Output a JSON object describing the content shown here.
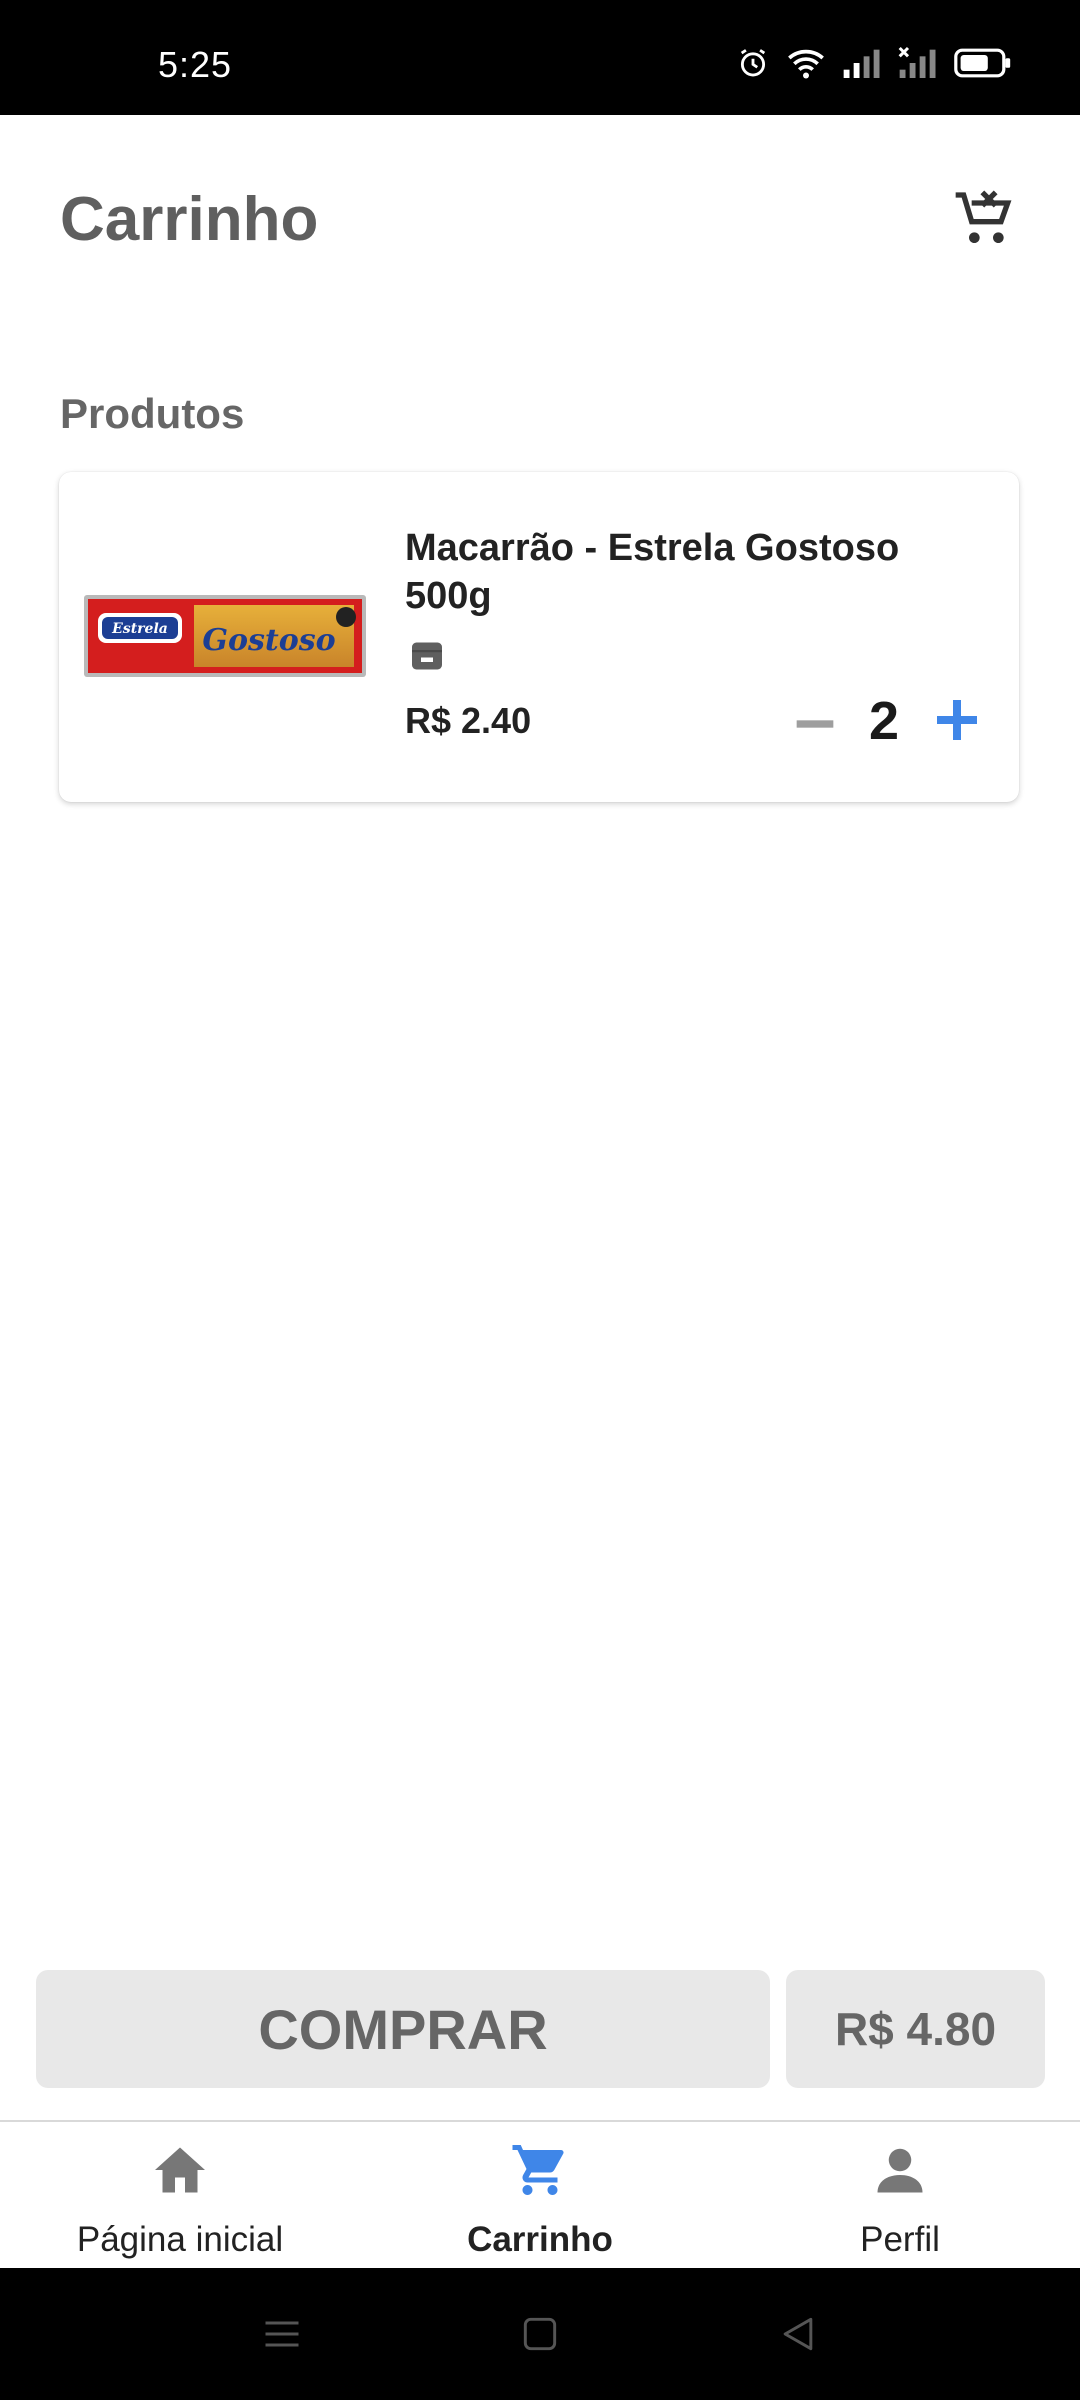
{
  "status_bar": {
    "time": "5:25",
    "icons": [
      "alarm-icon",
      "wifi-icon",
      "signal-icon",
      "signal-off-icon",
      "battery-icon"
    ]
  },
  "header": {
    "title": "Carrinho",
    "clear_cart_icon": "remove-shopping-cart-icon"
  },
  "section": {
    "title": "Produtos"
  },
  "cart_items": [
    {
      "name": "Macarrão - Estrela Gostoso 500g",
      "price": "R$ 2.40",
      "quantity": "2",
      "image_brand": "Estrela",
      "image_product": "Gostoso"
    }
  ],
  "footer": {
    "buy_label": "COMPRAR",
    "total": "R$ 4.80"
  },
  "bottom_nav": {
    "items": [
      {
        "label": "Página inicial",
        "icon": "home-icon",
        "active": false
      },
      {
        "label": "Carrinho",
        "icon": "cart-icon",
        "active": true
      },
      {
        "label": "Perfil",
        "icon": "person-icon",
        "active": false
      }
    ]
  },
  "colors": {
    "accent": "#3f86e8",
    "inactive_icon": "#777777",
    "button_bg": "#e8e8e8",
    "button_text": "#666666"
  }
}
